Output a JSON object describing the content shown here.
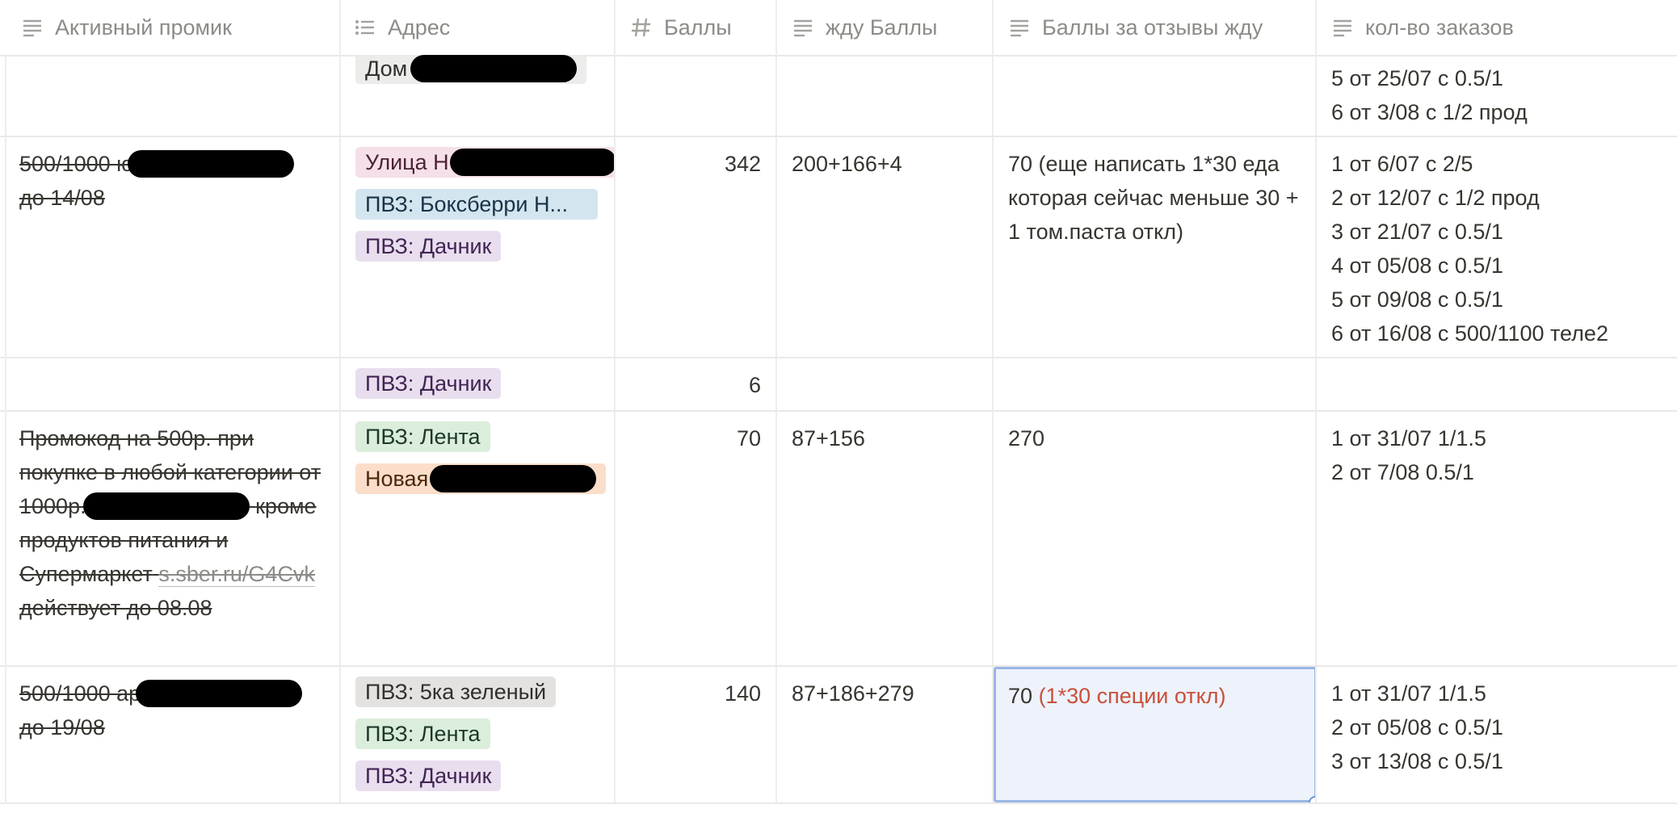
{
  "columns": [
    {
      "label": "Активный промик",
      "icon": "text-lines-icon"
    },
    {
      "label": "Адрес",
      "icon": "list-icon"
    },
    {
      "label": "Баллы",
      "icon": "hash-icon"
    },
    {
      "label": "жду Баллы",
      "icon": "text-lines-icon"
    },
    {
      "label": "Баллы за отзывы жду",
      "icon": "text-lines-icon"
    },
    {
      "label": "кол-во заказов",
      "icon": "text-lines-icon"
    }
  ],
  "rows": [
    {
      "address_tags": [
        {
          "label": "Дом",
          "color": "light"
        }
      ],
      "orders": "5 от 25/07 с 0.5/1\n6 от 3/08 с 1/2 прод"
    },
    {
      "promo_part1": "500/1000 ю",
      "promo_part2": "до 14/08",
      "address_tags": [
        {
          "label": "Улица Н",
          "color": "pink"
        },
        {
          "label": "ПВЗ: Боксберри Н...",
          "color": "blue"
        },
        {
          "label": "ПВЗ: Дачник",
          "color": "purple"
        }
      ],
      "points": "342",
      "waiting_points": "200+166+4",
      "review_points": "70 (еще написать 1*30 еда которая сейчас меньше 30 + 1 том.паста откл)",
      "orders": "1 от 6/07 с 2/5\n2 от 12/07 с 1/2 прод\n3 от 21/07 с 0.5/1\n4 от 05/08 с 0.5/1\n5 от 09/08 с 0.5/1\n6 от 16/08 с 500/1100 теле2"
    },
    {
      "address_tags": [
        {
          "label": "ПВЗ: Дачник",
          "color": "purple"
        }
      ],
      "points": "6"
    },
    {
      "promo_text_a": "Промокод на 500р. при покупке в любой категории от 1000р.",
      "promo_text_b": "кроме продуктов питания и Супермаркет",
      "promo_link": "s.sber.ru/G4Cvk",
      "promo_text_c": "действует до 08.08",
      "address_tags": [
        {
          "label": "ПВЗ: Лента",
          "color": "green"
        },
        {
          "label": "Новая",
          "color": "orange"
        }
      ],
      "points": "70",
      "waiting_points": "87+156",
      "review_points": "270",
      "orders": "1 от 31/07 1/1.5\n2 от 7/08 0.5/1"
    },
    {
      "promo_part1": "500/1000 ар",
      "promo_part2": "до 19/08",
      "address_tags": [
        {
          "label": "ПВЗ: 5ка зеленый",
          "color": "gray"
        },
        {
          "label": "ПВЗ: Лента",
          "color": "green"
        },
        {
          "label": "ПВЗ: Дачник",
          "color": "purple"
        }
      ],
      "points": "140",
      "waiting_points": "87+186+279",
      "review_points_main": "70",
      "review_points_note": "(1*30 специи откл)",
      "orders": "1 от 31/07 1/1.5\n2 от 05/08 с 0.5/1\n3 от 13/08 с 0.5/1"
    }
  ],
  "colors": {
    "selection_border": "#9ab6e6",
    "selection_bg": "#eef2fb",
    "note_red": "#c9503a"
  }
}
